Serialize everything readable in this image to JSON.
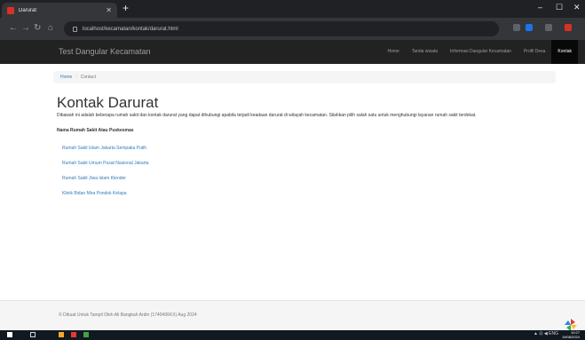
{
  "browser": {
    "tab_title": "Darurat",
    "new_tab": "+",
    "window_minimize": "–",
    "window_maximize": "☐",
    "window_close": "✕",
    "url": "localhost/kecamatan/kontak/darurat.html"
  },
  "navbar": {
    "brand": "Test Dangular Kecamatan",
    "links": [
      {
        "label": "Home"
      },
      {
        "label": "Tanda wisata"
      },
      {
        "label": "Informasi Dangular Kecamatan"
      },
      {
        "label": "Profil Desa"
      },
      {
        "label": "Kontak"
      }
    ]
  },
  "breadcrumb": {
    "home": "Home",
    "separator": "/",
    "current": "Contact"
  },
  "main": {
    "title": "Kontak Darurat",
    "description": "Dibawah ini adalah beberapa rumah sakit dan kontak darurat yang dapat dihubungi apabila terjadi keadaan darurat di wilayah kecamatan. Silahkan pilih salah satu untuk menghubungi layanan rumah sakit terdekat.",
    "list_heading": "Nama Rumah Sakit Atau Puskesmas",
    "hospitals": [
      "Rumah Sakit Islam Jakarta Sempaka Putih",
      "Rumah Sakit Umum Pusat Nasional Jakarta",
      "Rumah Sakit Jiwa Islam Klender",
      "Klinik Bidan Mira Pondok Kelapa"
    ]
  },
  "footer": {
    "text": "© Dibuat Untuk Tampil Oleh Ali Bangkah Ardin (1740499XX) Aug 2024"
  },
  "taskbar": {
    "tray": "▲ ⊡ ◀ ENG",
    "time": "10:27",
    "date": "19/08/2024"
  },
  "colors": {
    "navbar_bg": "#222222",
    "link": "#337ab7",
    "active_nav_bg": "#080808"
  }
}
